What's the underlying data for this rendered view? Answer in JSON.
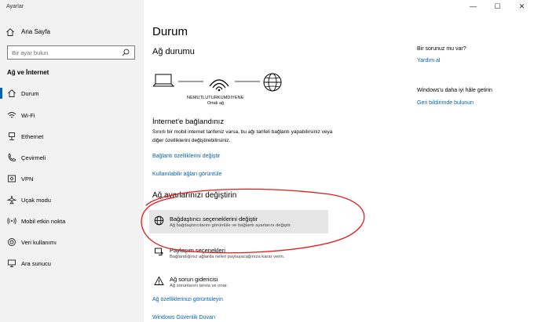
{
  "window": {
    "title": "Ayarlar",
    "minimize": "—",
    "maximize": "☐",
    "close": "✕"
  },
  "sidebar": {
    "home_label": "Ana Sayfa",
    "search_placeholder": "Bir ayar bulun",
    "section_title": "Ağ ve İnternet",
    "items": [
      {
        "label": "Durum",
        "icon": "home-status-icon",
        "active": true
      },
      {
        "label": "Wi-Fi",
        "icon": "wifi-icon"
      },
      {
        "label": "Ethernet",
        "icon": "ethernet-icon"
      },
      {
        "label": "Çevirmeli",
        "icon": "dialup-icon"
      },
      {
        "label": "VPN",
        "icon": "vpn-icon"
      },
      {
        "label": "Uçak modu",
        "icon": "airplane-icon"
      },
      {
        "label": "Mobil etkin nokta",
        "icon": "hotspot-icon"
      },
      {
        "label": "Veri kullanımı",
        "icon": "data-usage-icon"
      },
      {
        "label": "Ara sunucu",
        "icon": "proxy-icon"
      }
    ]
  },
  "main": {
    "title": "Durum",
    "network_status_title": "Ağ durumu",
    "network_name": "NEMUTLUTURKUMDIYENE",
    "network_type": "Ortak ağ",
    "internet_title": "İnternet'e bağlandınız",
    "internet_desc": "Sınırlı bir mobil internet tarifeniz varsa, bu ağı tarifeli bağlantı yapabilirsiniz veya diğer özelliklerini değiştirebilirsiniz.",
    "link_properties": "Bağlantı özelliklerini değiştir",
    "link_available": "Kullanılabilir ağları görüntüle",
    "change_title": "Ağ ayarlarınızı değiştirin",
    "options": [
      {
        "title": "Bağdaştırıcı seçeneklerini değiştir",
        "desc": "Ağ bağdaştırıcılarını görüntüle ve bağlantı ayarlarını değiştir."
      },
      {
        "title": "Paylaşım seçenekleri",
        "desc": "Bağlandığınız ağlarda neleri paylaşacağınıza karar verin."
      },
      {
        "title": "Ağ sorun gidericisi",
        "desc": "Ağ sorunlarını tanıla ve onar."
      }
    ],
    "link_view_props": "Ağ özelliklerinizi görüntüleyin",
    "link_firewall": "Windows Güvenlik Duvarı"
  },
  "right": {
    "question_title": "Bir sorunuz mu var?",
    "help_link": "Yardım al",
    "improve_title": "Windows'u daha iyi hâle getirin",
    "feedback_link": "Geri bildirimde bulunun"
  },
  "colors": {
    "accent": "#0063b1",
    "annotation": "#e31b1b",
    "sidebar_bg": "#f2f2f2",
    "highlight": "#e6e6e6"
  }
}
